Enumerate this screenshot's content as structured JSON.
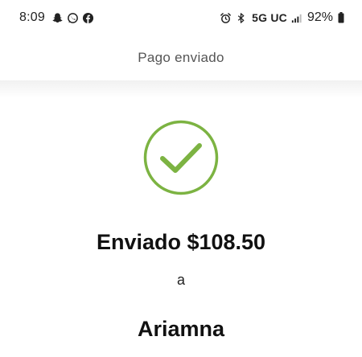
{
  "status_bar": {
    "time": "8:09",
    "left_icons": [
      "snapchat-icon",
      "whatsapp-icon",
      "facebook-icon"
    ],
    "right_icons": [
      "alarm-icon",
      "bluetooth-icon"
    ],
    "network": "5G UC",
    "battery": "92%"
  },
  "header": {
    "title": "Pago enviado"
  },
  "confirmation": {
    "check_icon": "check-circle-icon",
    "accent_color": "#7cb342",
    "sent_label": "Enviado $108.50",
    "to_word": "a",
    "recipient": "Ariamna"
  }
}
